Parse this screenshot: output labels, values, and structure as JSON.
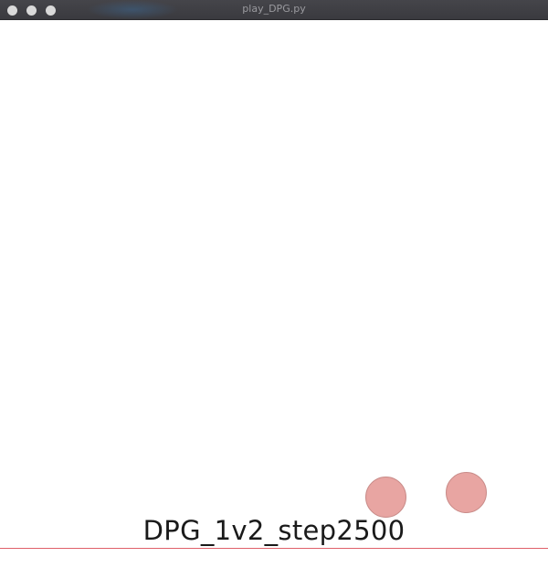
{
  "window": {
    "title": "play_DPG.py"
  },
  "scene": {
    "caption": "DPG_1v2_step2500",
    "agent_color": "#e8a5a2",
    "line_color": "#e0606a"
  }
}
